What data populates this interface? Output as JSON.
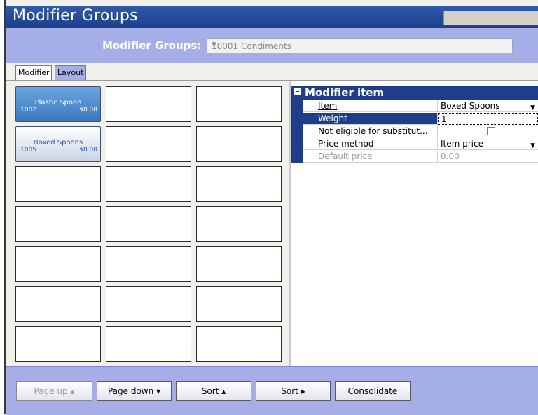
{
  "window": {
    "title": "Modifier Groups"
  },
  "group_selector": {
    "label": "Modifier Groups:",
    "value": "10001 Condiments"
  },
  "tabs": [
    {
      "label": "Modifier"
    },
    {
      "label": "Layout"
    }
  ],
  "grid": {
    "buttons": [
      {
        "name": "Plastic Spoon",
        "number": "1002",
        "price": "$0.00",
        "state": "selected"
      },
      {
        "name": "Boxed Spoons",
        "number": "1005",
        "price": "$0.00",
        "state": "normal"
      }
    ]
  },
  "properties": {
    "header": "Modifier item",
    "rows": [
      {
        "label": "Item",
        "value": "Boxed Spoons"
      },
      {
        "label": "Weight",
        "value": "1"
      },
      {
        "label": "Not eligible for substitut...",
        "value": ""
      },
      {
        "label": "Price method",
        "value": "Item price"
      },
      {
        "label": "Default price",
        "value": "0.00"
      }
    ]
  },
  "footer": {
    "page_up": "Page up ▴",
    "page_down": "Page down ▾",
    "sort_up": "Sort ▴",
    "sort_right": "Sort ▸",
    "consolidate": "Consolidate"
  },
  "colors": {
    "title_bar": "#1f3e8a",
    "panel": "#a5aee6",
    "selected_button": "#3a78c0"
  }
}
